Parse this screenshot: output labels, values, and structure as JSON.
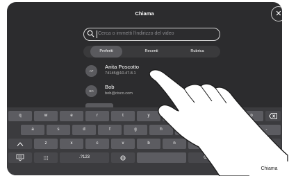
{
  "header": {
    "title": "Chiama",
    "close_icon": "close-icon"
  },
  "search": {
    "placeholder": "Cerca o immetti l'indirizzo del video"
  },
  "tabs": [
    {
      "label": "Preferiti",
      "active": true
    },
    {
      "label": "Recenti",
      "active": false
    },
    {
      "label": "Rubrica",
      "active": false
    }
  ],
  "contacts": [
    {
      "initials": "AP",
      "name": "Anita Poscotto",
      "address": "74145@10.47.8.1"
    },
    {
      "initials": "BO",
      "name": "Bob",
      "address": "bob@cisco.com"
    }
  ],
  "keyboard": {
    "row1": [
      "q",
      "w",
      "e",
      "r",
      "t",
      "y",
      "u",
      "i",
      "o",
      "p"
    ],
    "row2": [
      "a",
      "s",
      "d",
      "f",
      "g",
      "h",
      "j",
      "k",
      "l",
      "-"
    ],
    "row3": [
      "z",
      "x",
      "c",
      "v",
      "b",
      "n",
      "m"
    ],
    "numbers_label": ".?123",
    "at_label": "@",
    "backspace_icon": "backspace-icon",
    "shift_icon": "shift-icon",
    "emoji_icon": "emoji-icon",
    "hide_keyboard_icon": "keyboard-hide-icon",
    "globe_icon": "globe-icon"
  },
  "action": {
    "call_label": "Chiama"
  },
  "colors": {
    "panel": "#2c2c2e",
    "keyboard": "#3b3b3e",
    "key": "#5c5c61"
  }
}
